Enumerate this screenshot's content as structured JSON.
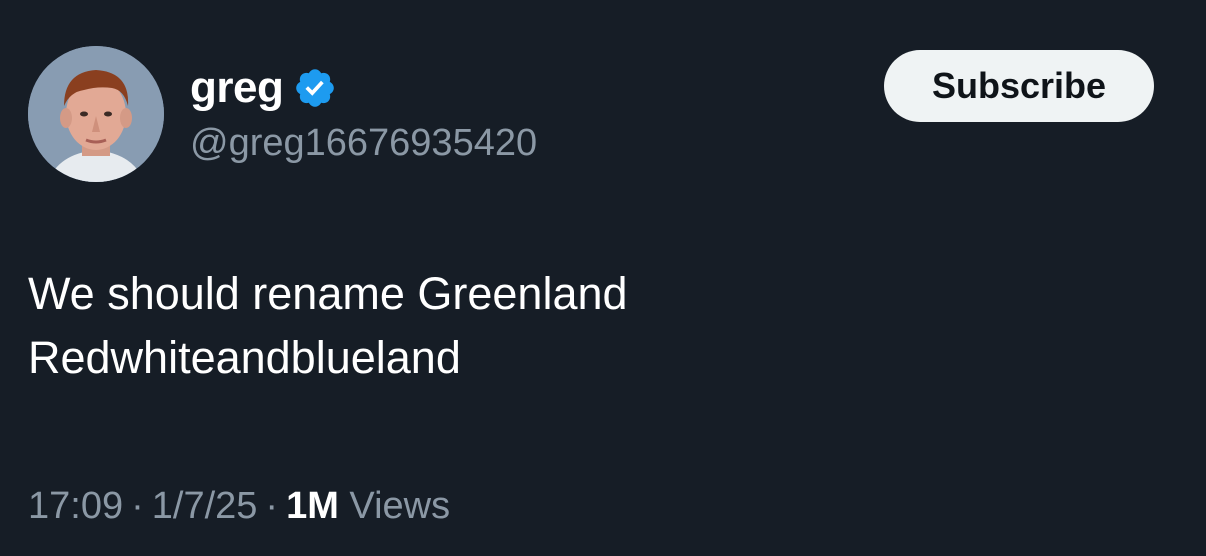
{
  "user": {
    "display_name": "greg",
    "handle": "@greg16676935420",
    "verified": true,
    "verified_color": "#1d9bf0"
  },
  "actions": {
    "subscribe_label": "Subscribe"
  },
  "tweet": {
    "lines": [
      "We should rename Greenland",
      "Redwhiteandblueland"
    ]
  },
  "meta": {
    "time": "17:09",
    "separator": "·",
    "date": "1/7/25",
    "views_count": "1M",
    "views_label": "Views"
  },
  "colors": {
    "background": "#161d26",
    "text": "#ffffff",
    "secondary": "#8b98a5",
    "button_bg": "#eff3f4"
  }
}
